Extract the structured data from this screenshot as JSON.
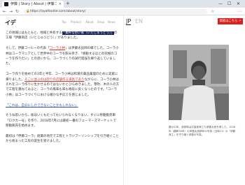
{
  "browser": {
    "tab_title": "伊藤 | Story | About | 伊藤コーヒー",
    "tab_close": "×",
    "new_tab": "+",
    "nav_back": "←",
    "nav_forward": "→",
    "nav_reload": "↻",
    "url_lock": "🔒",
    "url": "https://ayalfoodie.com/about/story/",
    "win_min": "—",
    "win_max": "☐",
    "win_close": "✕",
    "tool_fav": "☆",
    "tool_ext": "⋯"
  },
  "site": {
    "logo": "イデ",
    "nav": [
      "Top",
      "Product",
      "About",
      "Shop",
      "News"
    ],
    "lang_jp": "JP",
    "lang_en": "EN",
    "cta": "取扱はこちら ↗"
  },
  "article": {
    "p1_pre": "この地域にはもともと、地域と共有する",
    "p1_highlight": "「素朴な古い家（いえじゅうどう）」",
    "p1_post": "の工場「伊藤商店（いとじゅうどう）」がありました。",
    "p2_pre": "そして、伊藤コーヒーの代表「",
    "p2_link": "コーラ小林",
    "p2_post": "」は伊藤太良師の縁でした。コーラ小林はコーラマニアとして世界中のコーラを飲み歩き、「感動するほどの究極のコーラを作りたい」との思いから、コーラづくりの試行錯誤を繰り返していました。",
    "p3_pre": "コーラ作りを始めての3年と半年、コーラ小林は和漢の薬品薬理のために実家に帰りました。",
    "p3_link": "そこに並ぶのは誇りの店舗作る道具であり",
    "p3_post": "ながらに、コーラ小林はそれをコーラ作りに生かせるのではないかとひらめきました。芽吹、木の人の方で工程を重ねてみると、コーラの風味も味も格段に良くなったのです。「コーラ小林」はコーラづくりにおける確かな手応えを感じました。",
    "p4_link": "「これは、自分にしかできないことかもしれない」",
    "p5": "そうね思いから、彼はいくもたってもいられなくなりまい、すぐに移動販売車「ロクカー号」を作り、2018年7月には最初一番のフェーマーズマーケットで移動販売を始めます。",
    "p6_pre": "最初は「伊藤コーラ」創業の地元で工程とトラジプーソンシップを",
    "p6_post": "引き継ぐことから始まった工房の誕生を受けました。"
  },
  "photo": {
    "alt": "portrait-photo",
    "caption": "顧小の年、叔家時はお祖家商工も伊藤太良を承した。2018年（顧和30年）の伊藤太良師年の写真（当時11）の「伊藤商工」を守り継ぐ伊藤の写真。"
  }
}
